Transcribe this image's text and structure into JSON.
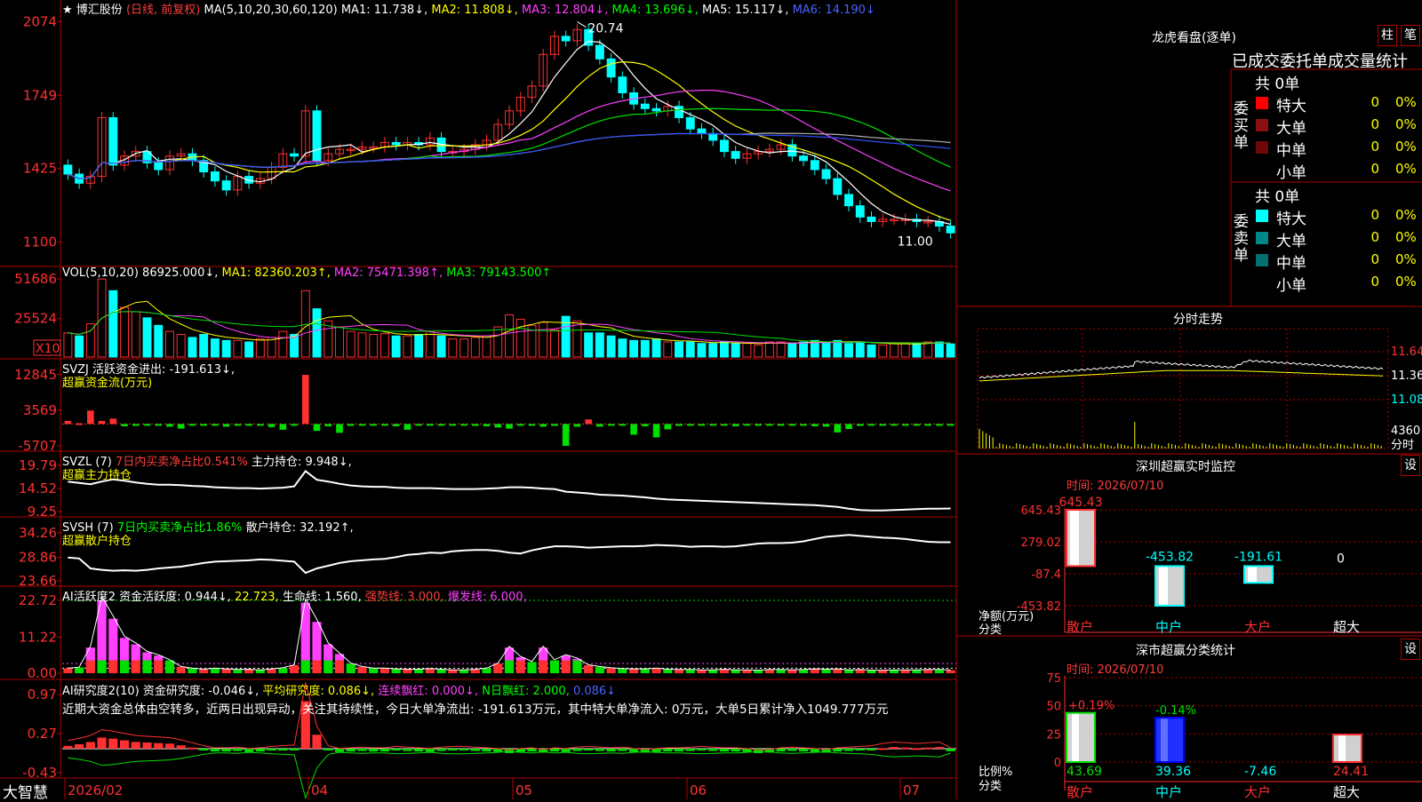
{
  "footer": {
    "logo": "大智慧",
    "dates": [
      "2026/02",
      "04",
      "05",
      "06",
      "07"
    ]
  },
  "panels": {
    "main": {
      "title_star": "★",
      "stock": "博汇股份",
      "mode": "(日线, 前复权)",
      "ma_params": "MA(5,10,20,30,60,120)",
      "ma1": "MA1: 11.738↓,",
      "ma2": "MA2: 11.808↓,",
      "ma3": "MA3: 12.804↓,",
      "ma4": "MA4: 13.696↓,",
      "ma5": "MA5: 15.117↓,",
      "ma6": "MA6: 14.190↓",
      "high_label": "20.74",
      "low_label": "11.00",
      "y_ticks": [
        "2074",
        "1749",
        "1425",
        "1100"
      ]
    },
    "vol": {
      "params": "VOL(5,10,20)",
      "value": "86925.000↓,",
      "ma1": "MA1: 82360.203↑,",
      "ma2": "MA2: 75471.398↑,",
      "ma3": "MA3: 79143.500↑",
      "y_ticks": [
        "51686",
        "25524"
      ],
      "unit": "X10"
    },
    "svzj": {
      "title": "SVZJ  活跃资金进出: -191.613↓,",
      "subtitle": "超赢资金流(万元)",
      "y_ticks": [
        "12845",
        "3569",
        "-5707"
      ]
    },
    "svzl": {
      "params": "SVZL (7)",
      "desc": "7日内买卖净占比0.541%",
      "value": "主力持仓: 9.948↓,",
      "subtitle": "超赢主力持仓",
      "y_ticks": [
        "19.79",
        "14.52",
        "9.25"
      ]
    },
    "svsh": {
      "params": "SVSH (7)",
      "desc": "7日内买卖净占比1.86%",
      "value": "散户持仓: 32.192↑,",
      "subtitle": "超赢散户持仓",
      "y_ticks": [
        "34.26",
        "28.86",
        "23.66"
      ]
    },
    "ai_active": {
      "p1": "AI活跃度2",
      "p2": "资金活跃度: 0.944↓,",
      "p3": "22.723,",
      "p4": "生命线: 1.560,",
      "p5": "强势线: 3.000,",
      "p6": "爆发线: 6.000,",
      "y_ticks": [
        "22.72",
        "11.22",
        "0.00"
      ]
    },
    "ai_research": {
      "p1": "AI研究度2(10)",
      "p2": "资金研究度: -0.046↓,",
      "p3": "平均研究度: 0.086↓,",
      "p4": "连续飘红: 0.000↓,",
      "p5": "N日飘红: 2.000,",
      "p6": "0.086↓",
      "comment": "近期大资金总体由空转多，近两日出现异动，关注其持续性，今日大单净流出: -191.613万元，其中特大单净流入: 0万元，大单5日累计净入1049.777万元",
      "y_ticks": [
        "0.97",
        "0.27",
        "-0.43"
      ]
    }
  },
  "right": {
    "dragon": {
      "title": "龙虎看盘(逐单)",
      "btn1": "柱",
      "btn2": "笔",
      "header": "已成交委托单成交量统计",
      "buy": {
        "side": "委买单",
        "total": "共 0单",
        "rows": [
          {
            "name": "特大",
            "n": "0",
            "p": "0%",
            "color": "#ff0000"
          },
          {
            "name": "大单",
            "n": "0",
            "p": "0%",
            "color": "#8b1010"
          },
          {
            "name": "中单",
            "n": "0",
            "p": "0%",
            "color": "#6e0808"
          },
          {
            "name": "小单",
            "n": "0",
            "p": "0%",
            "color": ""
          }
        ]
      },
      "sell": {
        "side": "委卖单",
        "total": "共 0单",
        "rows": [
          {
            "name": "特大",
            "n": "0",
            "p": "0%",
            "color": "#00ffff"
          },
          {
            "name": "大单",
            "n": "0",
            "p": "0%",
            "color": "#008888"
          },
          {
            "name": "中单",
            "n": "0",
            "p": "0%",
            "color": "#007070"
          },
          {
            "name": "小单",
            "n": "0",
            "p": "0%",
            "color": ""
          }
        ]
      }
    },
    "intraday": {
      "title": "分时走势",
      "y_ticks": [
        "11.64",
        "11.36",
        "11.08"
      ],
      "vol_tick": "4360",
      "vol_label": "分时"
    },
    "monitor": {
      "title": "深圳超赢实时监控",
      "btn": "设",
      "time": "时间: 2026/07/10",
      "y_ticks": [
        "645.43",
        "279.02",
        "-87.4",
        "-453.82"
      ],
      "y_label1": "净额(万元)",
      "y_label2": "分类",
      "categories": [
        "散户",
        "中户",
        "大户",
        "超大"
      ],
      "values": [
        645.43,
        -453.82,
        -191.61,
        0
      ],
      "value_labels": [
        "645.43",
        "-453.82",
        "-191.61",
        "0"
      ]
    },
    "classify": {
      "title": "深市超赢分类统计",
      "btn": "设",
      "time": "时间: 2026/07/10",
      "y_ticks": [
        "75",
        "50",
        "25",
        "0"
      ],
      "y_label1": "比例%",
      "y_label2": "分类",
      "categories": [
        "散户",
        "中户",
        "大户",
        "超大"
      ],
      "values": [
        43.69,
        39.36,
        -7.46,
        24.41
      ],
      "value_labels": [
        "43.69",
        "39.36",
        "-7.46",
        "24.41"
      ],
      "change_labels": [
        "+0.19%",
        "-0.14%"
      ]
    }
  },
  "chart_data": [
    {
      "type": "candlestick",
      "title": "博汇股份 (日线, 前复权)",
      "x_labels": [
        "2026/02",
        "04",
        "05",
        "06",
        "07"
      ],
      "ylim": [
        11.0,
        20.74
      ],
      "y_tick_labels": [
        "2074",
        "1749",
        "1425",
        "1100"
      ],
      "high": 20.74,
      "low": 11.0,
      "close": [
        14.0,
        13.6,
        13.9,
        16.5,
        14.4,
        14.8,
        15.0,
        14.5,
        14.2,
        14.8,
        14.9,
        14.6,
        14.1,
        13.7,
        13.3,
        13.9,
        13.6,
        13.8,
        14.3,
        14.9,
        14.8,
        16.8,
        14.6,
        14.9,
        15.1,
        15.1,
        15.2,
        15.2,
        15.4,
        15.3,
        15.4,
        15.3,
        15.6,
        15.0,
        15.0,
        15.1,
        15.3,
        15.5,
        16.2,
        16.8,
        17.4,
        17.9,
        19.3,
        20.1,
        19.9,
        20.4,
        19.7,
        19.1,
        18.3,
        17.6,
        17.1,
        16.9,
        16.8,
        17.0,
        16.5,
        16.0,
        15.8,
        15.5,
        15.0,
        14.7,
        14.9,
        15.0,
        15.1,
        15.3,
        14.8,
        14.6,
        14.2,
        13.8,
        13.1,
        12.6,
        12.1,
        11.9,
        12.0,
        12.0,
        12.0,
        11.9,
        11.9,
        11.7,
        11.4
      ]
    },
    {
      "type": "bar",
      "title": "VOL(5,10,20)",
      "unit": "X10",
      "ylim": [
        0,
        51686
      ],
      "values": [
        16000,
        14000,
        22000,
        51686,
        44000,
        33000,
        30000,
        26000,
        21000,
        17000,
        15000,
        13000,
        15000,
        12000,
        11000,
        11000,
        10000,
        12000,
        13000,
        17000,
        15000,
        44000,
        32000,
        24000,
        20000,
        17000,
        16000,
        15000,
        15500,
        14000,
        14000,
        15000,
        17000,
        14000,
        12000,
        12000,
        13000,
        14000,
        20000,
        28000,
        25000,
        21000,
        23000,
        18000,
        27000,
        24000,
        16000,
        16000,
        14000,
        12000,
        11000,
        11000,
        12000,
        10000,
        10000,
        10000,
        9000,
        9000,
        10000,
        9000,
        9000,
        8000,
        10000,
        10000,
        9000,
        10000,
        11000,
        10000,
        11000,
        9000,
        10000,
        8000,
        8000,
        9000,
        9000,
        9000,
        10000,
        10000,
        8692
      ]
    },
    {
      "type": "bar",
      "title": "超赢资金流(万元)",
      "ylim": [
        -5707,
        12845
      ],
      "values": [
        800,
        200,
        3500,
        800,
        1400,
        -600,
        -500,
        -200,
        -300,
        -700,
        -1200,
        -300,
        -300,
        -400,
        -700,
        -300,
        -400,
        -300,
        -800,
        -1500,
        -400,
        12845,
        -1800,
        -600,
        -2300,
        -500,
        -300,
        -400,
        -300,
        -600,
        -1500,
        -300,
        -400,
        -400,
        -300,
        -400,
        -500,
        -600,
        -900,
        -1200,
        -400,
        -300,
        -700,
        -500,
        -5707,
        -700,
        1200,
        -700,
        -300,
        -300,
        -2800,
        -600,
        -3500,
        -1400,
        -500,
        -400,
        -300,
        -300,
        -400,
        -600,
        -300,
        -200,
        -400,
        -300,
        -300,
        -400,
        -600,
        -700,
        -2200,
        -1300,
        -500,
        -400,
        -300,
        -200,
        -300,
        -300,
        -200,
        -300,
        -200
      ]
    },
    {
      "type": "line",
      "title": "超赢主力持仓",
      "ylim": [
        9.25,
        19.79
      ],
      "values": [
        16.1,
        15.8,
        15.5,
        16.1,
        16.6,
        16.3,
        15.9,
        15.6,
        15.4,
        15.4,
        15.3,
        15.1,
        15.0,
        14.8,
        14.7,
        14.6,
        14.6,
        14.5,
        14.6,
        14.7,
        15.0,
        18.5,
        16.5,
        16.1,
        15.6,
        15.2,
        15.0,
        14.9,
        14.9,
        14.7,
        14.6,
        14.6,
        14.6,
        14.5,
        14.4,
        14.4,
        14.4,
        14.5,
        14.6,
        14.8,
        14.8,
        14.7,
        14.5,
        14.4,
        13.8,
        13.6,
        13.4,
        13.1,
        13.0,
        12.9,
        12.7,
        12.5,
        12.2,
        12.0,
        11.9,
        11.8,
        11.7,
        11.6,
        11.5,
        11.4,
        11.3,
        11.2,
        11.1,
        11.0,
        10.9,
        10.8,
        10.7,
        10.5,
        10.3,
        9.9,
        9.6,
        9.5,
        9.5,
        9.6,
        9.7,
        9.8,
        9.9,
        9.9,
        9.95
      ]
    },
    {
      "type": "line",
      "title": "超赢散户持仓",
      "ylim": [
        23.66,
        34.26
      ],
      "values": [
        28.8,
        28.6,
        26.4,
        26.1,
        25.9,
        26.0,
        25.9,
        26.1,
        26.4,
        26.6,
        26.8,
        27.2,
        27.6,
        27.9,
        28.0,
        28.1,
        28.2,
        28.4,
        28.3,
        28.1,
        27.9,
        25.4,
        26.4,
        27.0,
        27.6,
        28.0,
        28.2,
        28.4,
        28.5,
        28.9,
        29.4,
        29.6,
        29.9,
        29.8,
        30.2,
        30.4,
        30.5,
        30.5,
        30.3,
        29.9,
        29.7,
        30.4,
        30.9,
        31.3,
        31.3,
        31.2,
        31.0,
        31.1,
        31.2,
        31.3,
        31.3,
        31.4,
        31.6,
        31.5,
        31.4,
        31.2,
        31.3,
        31.3,
        31.2,
        31.3,
        31.6,
        31.9,
        32.0,
        32.0,
        32.1,
        32.4,
        32.9,
        33.4,
        33.6,
        33.8,
        33.6,
        33.4,
        33.2,
        33.1,
        32.9,
        32.6,
        32.3,
        32.2,
        32.19
      ]
    },
    {
      "type": "bar",
      "title": "AI活跃度2",
      "ylim": [
        0,
        22.72
      ],
      "values": [
        1.5,
        1.8,
        8.0,
        22.72,
        17.0,
        11.0,
        9.0,
        6.5,
        5.5,
        4.0,
        2.0,
        1.5,
        1.2,
        1.5,
        1.3,
        1.1,
        1.2,
        1.0,
        1.3,
        1.6,
        2.5,
        22.0,
        16.0,
        9.0,
        6.0,
        3.0,
        2.0,
        1.5,
        1.5,
        1.3,
        1.2,
        1.2,
        1.4,
        1.2,
        1.0,
        1.0,
        1.2,
        1.5,
        3.0,
        8.0,
        5.0,
        3.5,
        8.0,
        4.0,
        5.5,
        4.5,
        2.5,
        2.0,
        1.6,
        1.4,
        1.3,
        1.3,
        1.5,
        1.2,
        1.1,
        1.1,
        1.0,
        1.0,
        1.2,
        1.0,
        1.0,
        0.9,
        1.1,
        1.1,
        1.0,
        1.1,
        1.3,
        1.2,
        1.3,
        1.0,
        1.1,
        0.9,
        0.9,
        1.0,
        1.0,
        1.0,
        1.1,
        1.1,
        0.94
      ]
    },
    {
      "type": "bar",
      "title": "AI研究度2(10)",
      "ylim": [
        -0.43,
        0.97
      ],
      "values": [
        0.05,
        0.08,
        0.12,
        0.2,
        0.18,
        0.15,
        0.12,
        0.11,
        0.1,
        0.09,
        0.06,
        0.02,
        -0.02,
        -0.05,
        -0.05,
        -0.04,
        -0.06,
        -0.05,
        -0.03,
        -0.02,
        -0.01,
        0.85,
        0.25,
        -0.02,
        -0.06,
        -0.05,
        -0.04,
        -0.05,
        -0.05,
        -0.03,
        -0.04,
        -0.05,
        -0.06,
        -0.04,
        -0.03,
        -0.03,
        -0.04,
        -0.05,
        -0.06,
        -0.08,
        -0.06,
        -0.05,
        -0.07,
        -0.05,
        -0.06,
        -0.04,
        -0.03,
        -0.04,
        -0.05,
        -0.04,
        -0.06,
        -0.07,
        -0.06,
        -0.05,
        -0.05,
        -0.04,
        -0.03,
        -0.04,
        -0.05,
        -0.05,
        -0.06,
        -0.08,
        -0.07,
        -0.05,
        -0.04,
        -0.05,
        -0.06,
        -0.07,
        -0.05,
        -0.04,
        -0.03,
        -0.02,
        0.01,
        0.03,
        0.02,
        0.01,
        0.02,
        0.03,
        -0.046
      ]
    },
    {
      "type": "bar",
      "title": "深圳超赢实时监控",
      "categories": [
        "散户",
        "中户",
        "大户",
        "超大"
      ],
      "values": [
        645.43,
        -453.82,
        -191.61,
        0
      ],
      "ylabel": "净额(万元)",
      "xlabel": "分类"
    },
    {
      "type": "bar",
      "title": "深市超赢分类统计",
      "categories": [
        "散户",
        "中户",
        "大户",
        "超大"
      ],
      "values": [
        43.69,
        39.36,
        -7.46,
        24.41
      ],
      "ylabel": "比例%",
      "xlabel": "分类"
    }
  ]
}
